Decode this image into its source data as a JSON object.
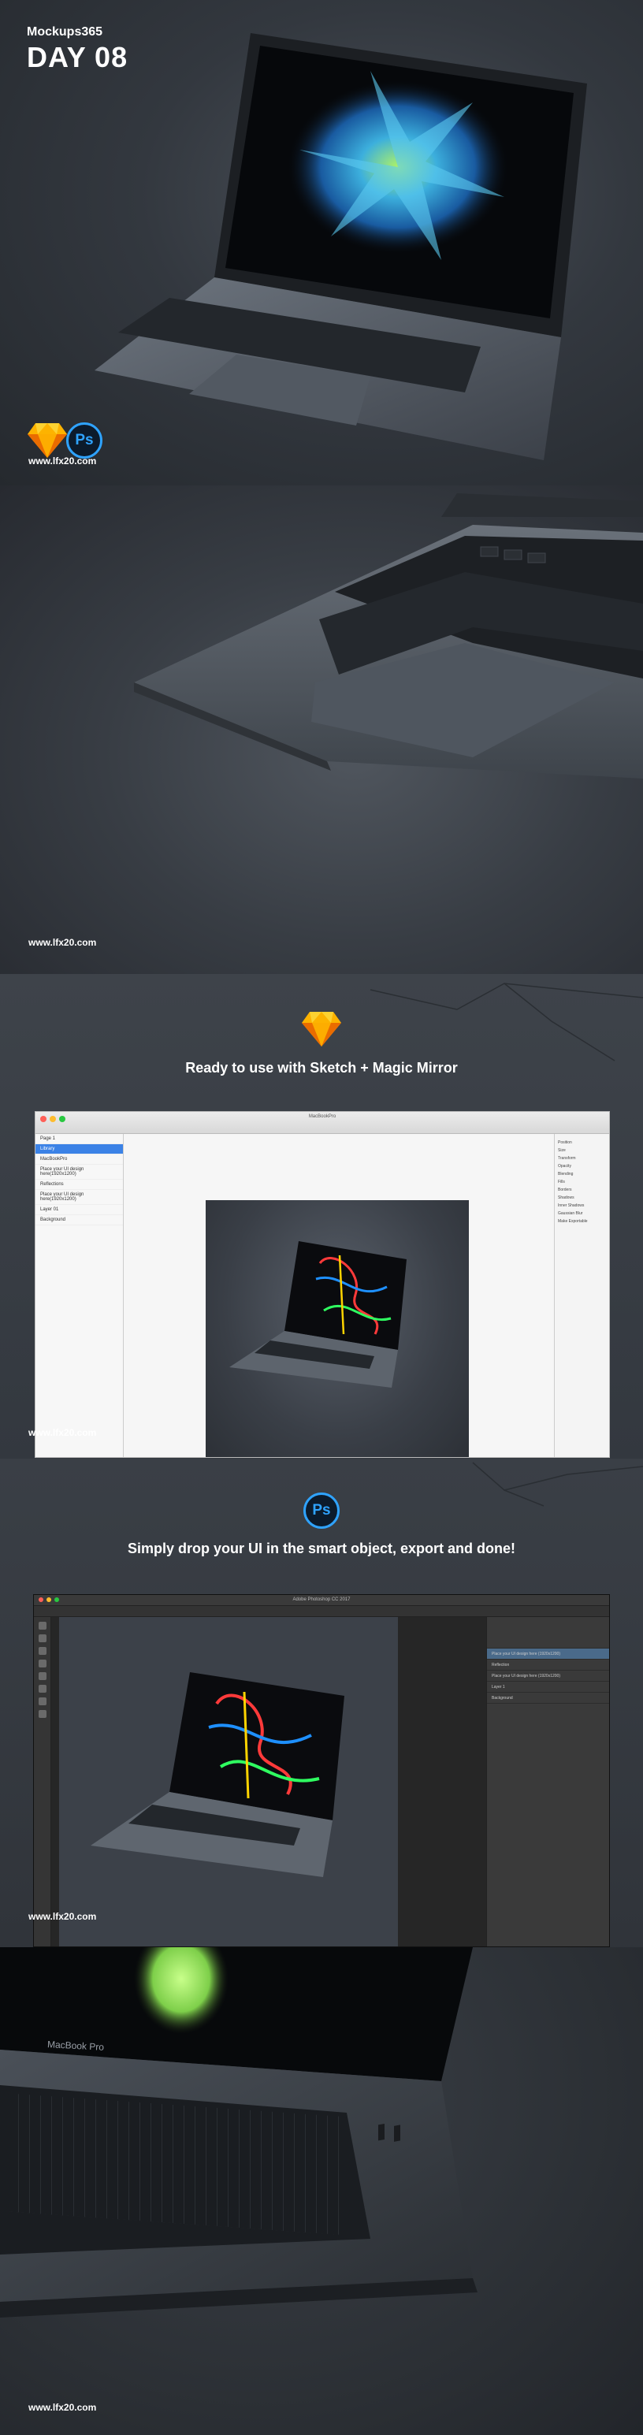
{
  "panel1": {
    "brand": "Mockups365",
    "day": "DAY 08",
    "url": "www.lfx20.com",
    "logos": {
      "sketch": "sketch-logo",
      "photoshop": "Ps"
    }
  },
  "panel2": {
    "url": "www.lfx20.com"
  },
  "panel3": {
    "heading": "Ready to use with Sketch + Magic Mirror",
    "url": "www.lfx20.com",
    "sketch_window": {
      "title": "MacBookPro",
      "left_items": [
        "Page 1",
        "Library",
        "MacBookPro",
        "Place your UI design here(1920x1200)",
        "Reflections",
        "Place your UI design here(1920x1200)",
        "Layer 01",
        "Background"
      ],
      "right_items": [
        "Position",
        "Size",
        "Transform",
        "Opacity",
        "Blending",
        "Fills",
        "Borders",
        "Shadows",
        "Inner Shadows",
        "Gaussian Blur",
        "Make Exportable"
      ]
    }
  },
  "panel4": {
    "heading": "Simply drop your UI in the smart object, export and done!",
    "url": "www.lfx20.com",
    "ps_logo": "Ps",
    "ps_window": {
      "title": "Adobe Photoshop CC 2017",
      "layers": [
        "Place your UI design here (1920x1200)",
        "Reflection",
        "Place your UI design here (1920x1200)",
        "Layer 1",
        "Background"
      ]
    }
  },
  "panel5": {
    "url": "www.lfx20.com",
    "laptop_label": "MacBook Pro"
  },
  "colors": {
    "accent_blue": "#2fa3ff",
    "sketch_orange": "#f7a800",
    "bg_dark": "#2c3036"
  }
}
